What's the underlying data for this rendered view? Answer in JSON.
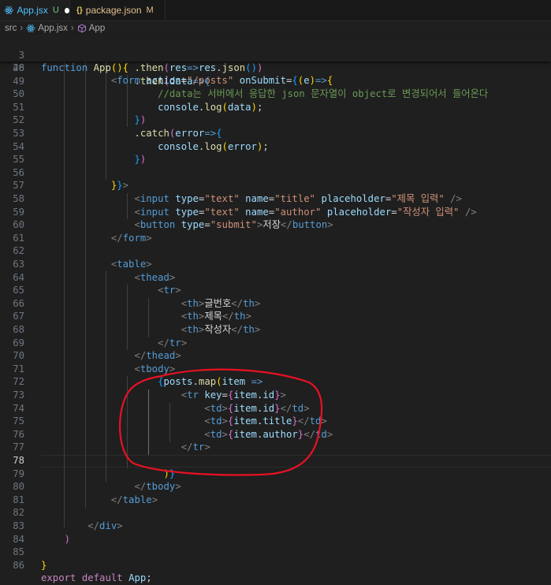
{
  "tabs": [
    {
      "name": "App.jsx",
      "badge": "U",
      "modified": true
    },
    {
      "name": "package.json",
      "badge": "M",
      "icon_text": "{}"
    }
  ],
  "breadcrumb": [
    "src",
    "App.jsx",
    "App"
  ],
  "lines": {
    "n3": "3",
    "n26": "26",
    "n48": "48",
    "n49": "49",
    "n50": "50",
    "n51": "51",
    "n52": "52",
    "n53": "53",
    "n54": "54",
    "n55": "55",
    "n56": "56",
    "n57": "57",
    "n58": "58",
    "n59": "59",
    "n60": "60",
    "n61": "61",
    "n62": "62",
    "n63": "63",
    "n64": "64",
    "n65": "65",
    "n66": "66",
    "n67": "67",
    "n68": "68",
    "n69": "69",
    "n70": "70",
    "n71": "71",
    "n72": "72",
    "n73": "73",
    "n74": "74",
    "n75": "75",
    "n76": "76",
    "n77": "77",
    "n78": "78",
    "n79": "79",
    "n80": "80",
    "n81": "81",
    "n82": "82",
    "n83": "83",
    "n84": "84",
    "n85": "85",
    "n86": "86"
  },
  "code": {
    "kw_function": "function",
    "fn_app": "App",
    "kw_export": "export",
    "kw_default": "default",
    "comment": "//data는 서버에서 응답한 json 문자열이 object로 변경되어서 들어온다",
    "str_posts": "\"/posts\"",
    "str_text": "\"text\"",
    "str_title": "\"title\"",
    "str_title_ph": "\"제목 입력\"",
    "str_author": "\"author\"",
    "str_author_ph": "\"작성자 입력\"",
    "str_submit": "\"submit\"",
    "btn_text": "저장",
    "th_no": "글번호",
    "th_title": "제목",
    "th_author": "작성자"
  },
  "colors": {
    "background": "#1f1f1f",
    "annotation_circle": "#e81123",
    "keyword": "#569cd6",
    "string": "#ce9178",
    "comment": "#6a9955"
  }
}
